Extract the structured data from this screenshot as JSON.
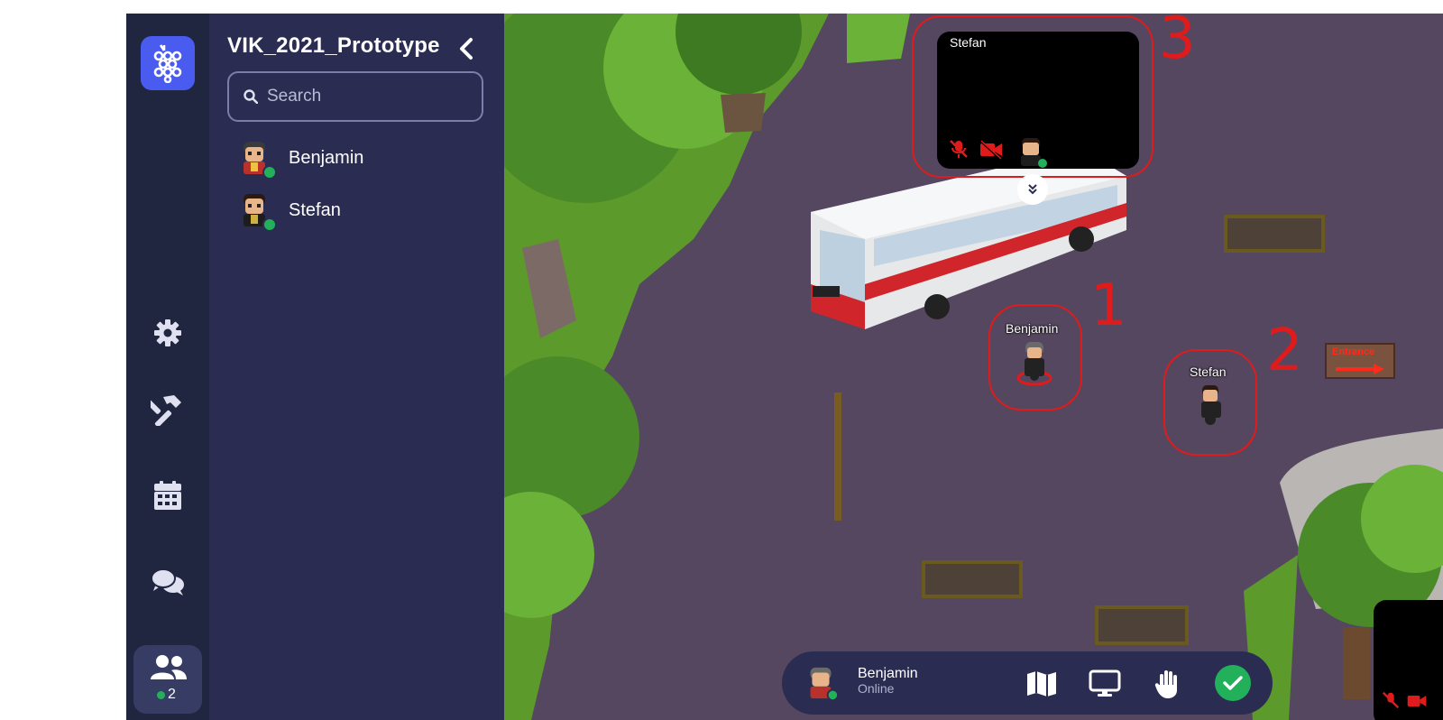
{
  "space": {
    "title": "VIK_2021_Prototype"
  },
  "search": {
    "placeholder": "Search",
    "value": ""
  },
  "members": [
    {
      "name": "Benjamin",
      "status": "online"
    },
    {
      "name": "Stefan",
      "status": "online"
    }
  ],
  "rail": {
    "items": [
      "gear-icon",
      "hammer-icon",
      "calendar-icon",
      "chat-icon",
      "people-icon"
    ],
    "online_count": "2"
  },
  "game": {
    "video_tile": {
      "name": "Stefan",
      "mic": "muted",
      "camera": "off"
    },
    "avatars": [
      {
        "name": "Benjamin",
        "marker": "1"
      },
      {
        "name": "Stefan",
        "marker": "2"
      }
    ],
    "video_marker": "3",
    "sign_text": "Entrance"
  },
  "bottom_bar": {
    "user_name": "Benjamin",
    "user_status": "Online",
    "buttons": [
      "map-icon",
      "screen-share-icon",
      "raise-hand-icon",
      "ready-check-icon"
    ]
  },
  "colors": {
    "rail_bg": "#202540",
    "panel_bg": "#2a2c52",
    "accent": "#4a5cf0",
    "online": "#22b15a",
    "marker": "#e01b1b",
    "ground": "#55475f"
  }
}
